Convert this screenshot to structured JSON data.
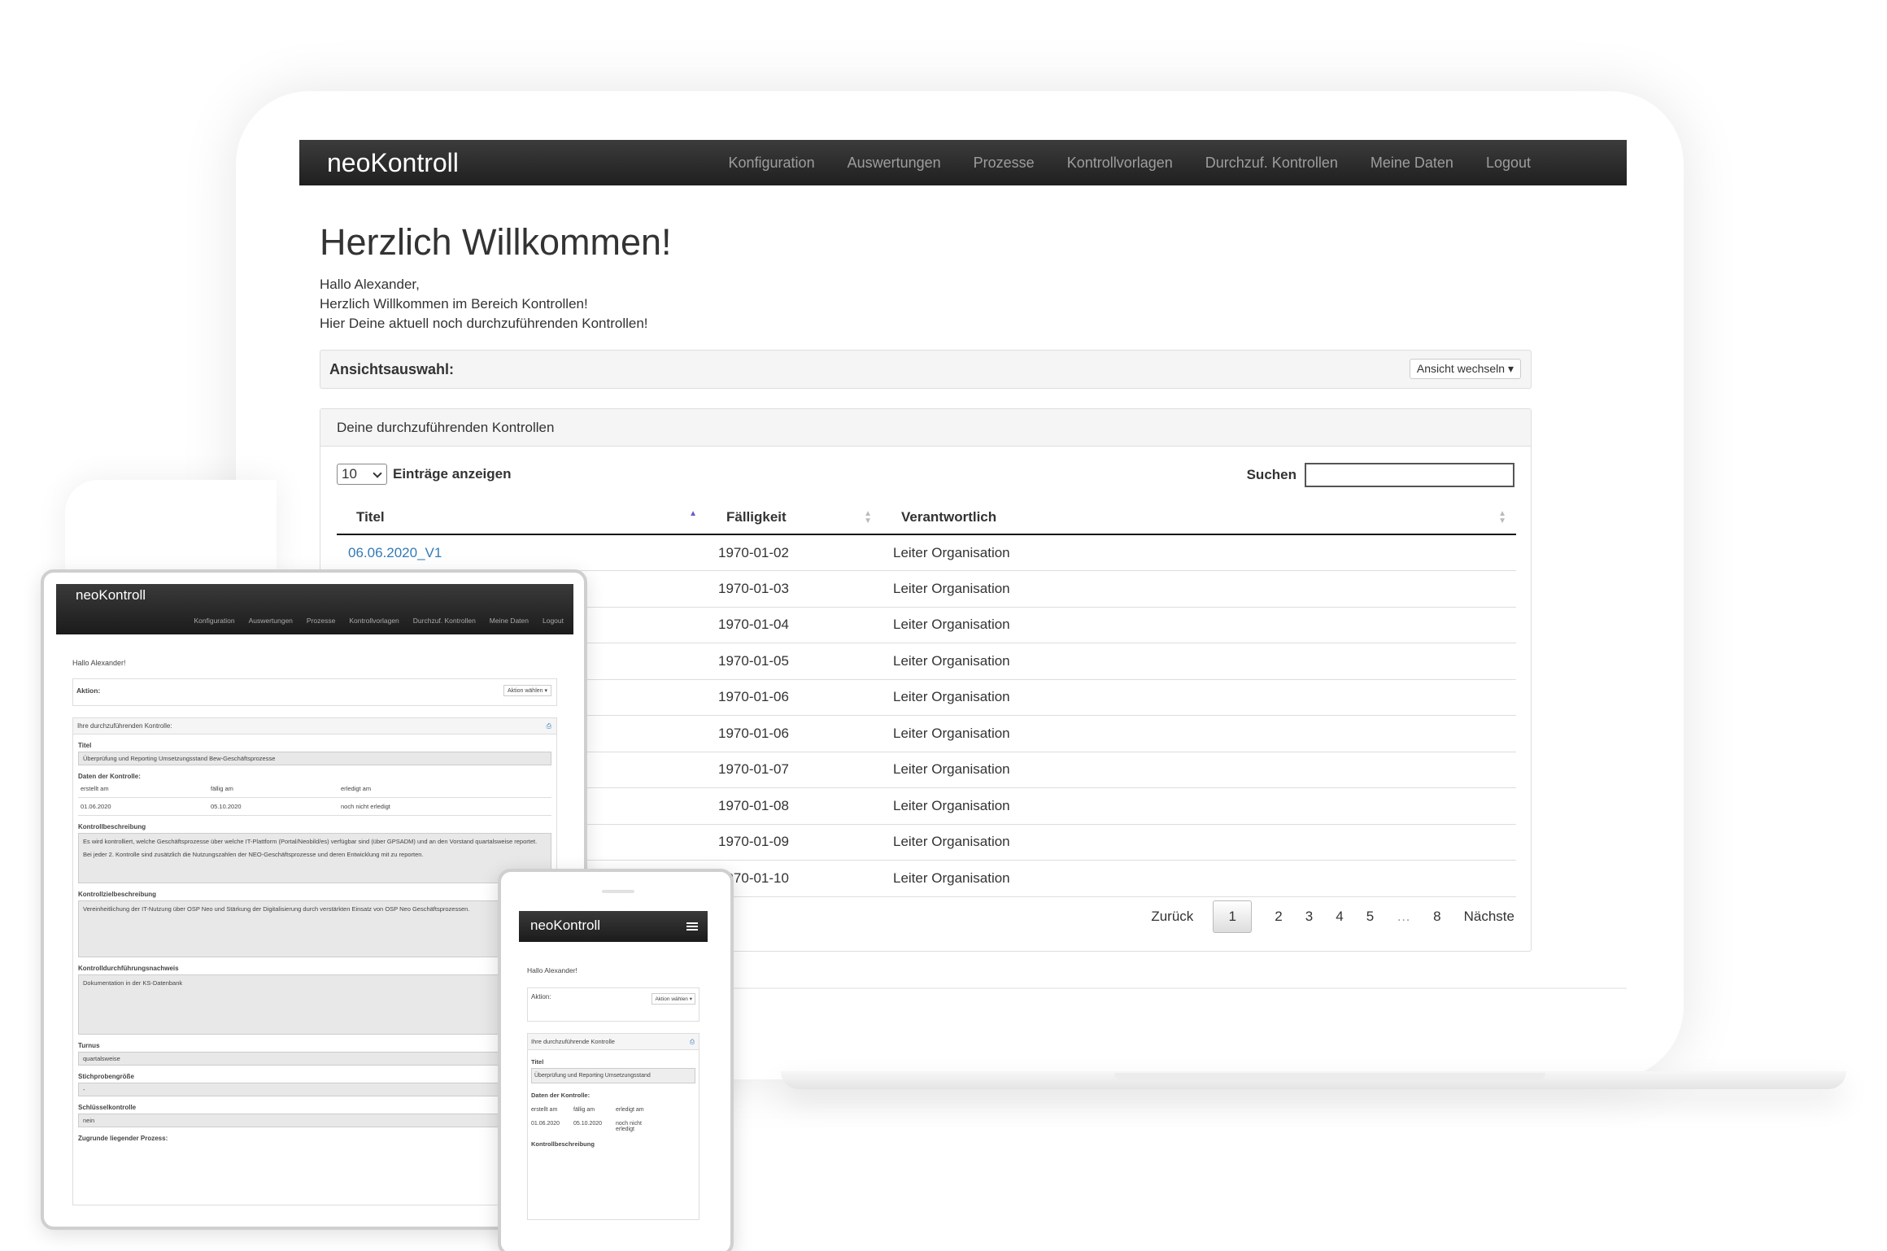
{
  "desktop": {
    "brand": "neoKontroll",
    "nav": [
      "Konfiguration",
      "Auswertungen",
      "Prozesse",
      "Kontrollvorlagen",
      "Durchzuf. Kontrollen",
      "Meine Daten",
      "Logout"
    ],
    "heading": "Herzlich Willkommen!",
    "intro": [
      "Hallo Alexander,",
      "Herzlich Willkommen im Bereich Kontrollen!",
      "Hier Deine aktuell noch durchzuführenden Kontrollen!"
    ],
    "view_label": "Ansichtsauswahl:",
    "view_button": "Ansicht wechseln ▾",
    "panel_title": "Deine durchzuführenden Kontrollen",
    "length_value": "10",
    "length_label": "Einträge anzeigen",
    "search_label": "Suchen",
    "columns": [
      "Titel",
      "Fälligkeit",
      "Verantwortlich"
    ],
    "rows": [
      {
        "title": "06.06.2020_V1",
        "due": "1970-01-02",
        "owner": "Leiter Organisation"
      },
      {
        "title": "",
        "due": "1970-01-03",
        "owner": "Leiter Organisation"
      },
      {
        "title": "",
        "due": "1970-01-04",
        "owner": "Leiter Organisation"
      },
      {
        "title": "",
        "due": "1970-01-05",
        "owner": "Leiter Organisation"
      },
      {
        "title": "",
        "due": "1970-01-06",
        "owner": "Leiter Organisation"
      },
      {
        "title": "",
        "due": "1970-01-06",
        "owner": "Leiter Organisation"
      },
      {
        "title": "",
        "due": "1970-01-07",
        "owner": "Leiter Organisation"
      },
      {
        "title": "",
        "due": "1970-01-08",
        "owner": "Leiter Organisation"
      },
      {
        "title": "",
        "due": "1970-01-09",
        "owner": "Leiter Organisation"
      },
      {
        "title": "",
        "due": "1970-01-10",
        "owner": "Leiter Organisation"
      }
    ],
    "pager": {
      "prev": "Zurück",
      "current": "1",
      "pages": [
        "2",
        "3",
        "4",
        "5"
      ],
      "dots": "…",
      "last": "8",
      "next": "Nächste"
    }
  },
  "tablet": {
    "brand": "neoKontroll",
    "nav": [
      "Konfiguration",
      "Auswertungen",
      "Prozesse",
      "Kontrollvorlagen",
      "Durchzuf. Kontrollen",
      "Meine Daten",
      "Logout"
    ],
    "hello": "Hallo Alexander!",
    "action_label": "Aktion:",
    "action_button": "Aktion wählen ▾",
    "panel_title": "Ihre durchzuführenden Kontrolle:",
    "title_label": "Titel",
    "title_value": "Überprüfung und Reporting Umsetzungsstand Bew-Geschäftsprozesse",
    "data_label": "Daten der Kontrolle:",
    "grid_head": [
      "erstellt am",
      "fällig am",
      "erledigt am"
    ],
    "grid_row": [
      "01.06.2020",
      "05.10.2020",
      "noch nicht erledigt"
    ],
    "desc_label": "Kontrollbeschreibung",
    "desc_text": "Es wird kontrolliert, welche Geschäftsprozesse über welche IT-Plattform (Portal/Neobild/es) verfügbar sind (über GPSADM) und an den Vorstand quartalsweise reportet.",
    "desc_text2": "Bei jeder 2. Kontrolle sind zusätzlich die Nutzungszahlen der NEO-Geschäftsprozesse und deren Entwicklung mit zu reporten.",
    "goal_label": "Kontrollzielbeschreibung",
    "goal_text": "Vereinheitlichung der IT-Nutzung über OSP Neo und Stärkung der Digitalisierung durch verstärkten Einsatz von OSP Neo Geschäftsprozessen.",
    "proof_label": "Kontrolldurchführungsnachweis",
    "proof_text": "Dokumentation in der KS-Datenbank",
    "turnus_label": "Turnus",
    "turnus_value": "quartalsweise",
    "sample_label": "Stichprobengröße",
    "sample_value": "-",
    "key_label": "Schlüsselkontrolle",
    "key_value": "nein",
    "process_label": "Zugrunde liegender Prozess:"
  },
  "phone": {
    "brand": "neoKontroll",
    "hello": "Hallo Alexander!",
    "action_label": "Aktion:",
    "action_button": "Aktion wählen ▾",
    "panel_title": "Ihre durchzuführende Kontrolle",
    "title_label": "Titel",
    "title_value": "Überprüfung und Reporting Umsetzungsstand",
    "data_label": "Daten der Kontrolle:",
    "grid_head": [
      "erstellt am",
      "fällig am",
      "erledigt am"
    ],
    "grid_row": [
      "01.06.2020",
      "05.10.2020",
      "noch nicht erledigt"
    ],
    "desc_label": "Kontrollbeschreibung"
  }
}
